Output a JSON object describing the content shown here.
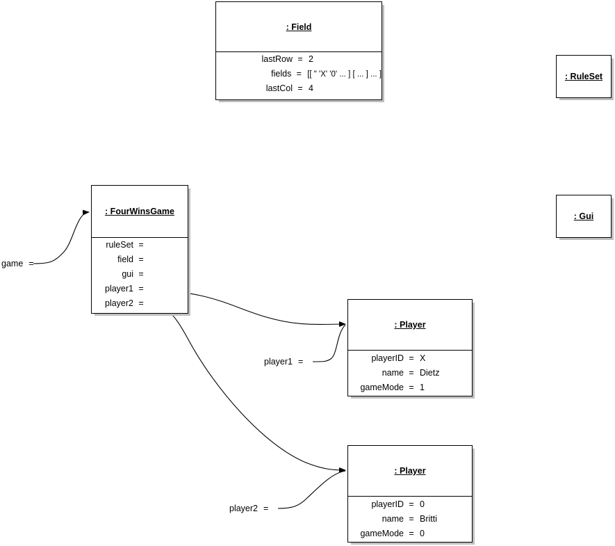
{
  "diagram": {
    "type": "uml-object-diagram",
    "background": "#ffffff",
    "line_color": "#000000",
    "shadow_color": "#bfbfbf"
  },
  "objects": {
    "field": {
      "title": ": Field",
      "attributes": [
        {
          "name": "lastRow",
          "eq": "=",
          "value": "2"
        },
        {
          "name": "fields",
          "eq": "=",
          "value": "[[ \" 'X' '0' ... ] [ ... ] ... ]"
        },
        {
          "name": "lastCol",
          "eq": "=",
          "value": "4"
        }
      ]
    },
    "ruleset": {
      "title": ": RuleSet",
      "attributes": []
    },
    "gui": {
      "title": ": Gui",
      "attributes": []
    },
    "fourwinsgame": {
      "title": ": FourWinsGame",
      "attributes": [
        {
          "name": "ruleSet",
          "eq": "=",
          "value": ""
        },
        {
          "name": "field",
          "eq": "=",
          "value": ""
        },
        {
          "name": "gui",
          "eq": "=",
          "value": ""
        },
        {
          "name": "player1",
          "eq": "=",
          "value": ""
        },
        {
          "name": "player2",
          "eq": "=",
          "value": ""
        }
      ]
    },
    "player_one": {
      "title": ": Player",
      "attributes": [
        {
          "name": "playerID",
          "eq": "=",
          "value": "X"
        },
        {
          "name": "name",
          "eq": "=",
          "value": "Dietz"
        },
        {
          "name": "gameMode",
          "eq": "=",
          "value": "1"
        }
      ]
    },
    "player_two": {
      "title": ": Player",
      "attributes": [
        {
          "name": "playerID",
          "eq": "=",
          "value": "0"
        },
        {
          "name": "name",
          "eq": "=",
          "value": "Britti"
        },
        {
          "name": "gameMode",
          "eq": "=",
          "value": "0"
        }
      ]
    }
  },
  "links": [
    {
      "id": "game",
      "label": "game",
      "eq": "=",
      "target": "fourwinsgame"
    },
    {
      "id": "player1",
      "label": "player1",
      "eq": "=",
      "target": "player_one"
    },
    {
      "id": "player2",
      "label": "player2",
      "eq": "=",
      "target": "player_two"
    }
  ]
}
